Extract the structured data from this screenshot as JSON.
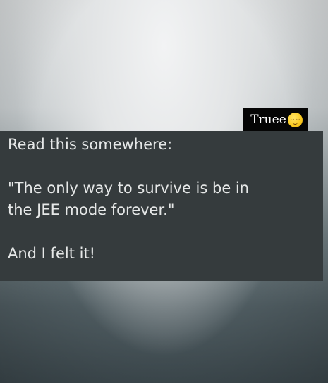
{
  "tag": {
    "label": "Truee",
    "emoji": "relieved-face-emoji"
  },
  "card": {
    "lines": [
      "Read this somewhere:",
      "\"The only way to survive is be in",
      "the JEE mode forever.\"",
      "And I felt it!"
    ]
  }
}
